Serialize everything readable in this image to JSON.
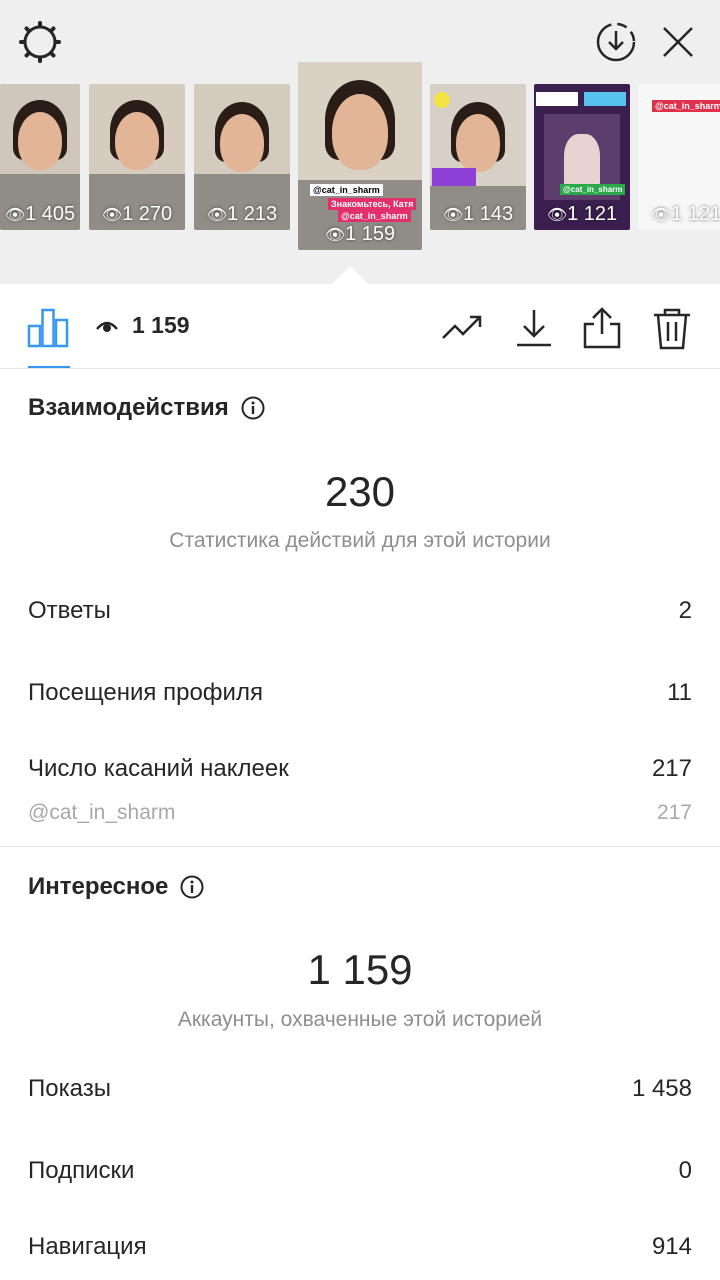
{
  "header": {
    "settings_icon": "gear-icon",
    "download_icon": "download-circle-icon",
    "close_icon": "close-icon"
  },
  "stories": [
    {
      "views": "1 405"
    },
    {
      "views": "1 270"
    },
    {
      "views": "1 213"
    },
    {
      "views": "1 159",
      "mention": "@cat_in_sharm",
      "caption": "Знакомьтесь, Катя",
      "mention2": "@cat_in_sharm"
    },
    {
      "views": "1 143"
    },
    {
      "views": "1 121",
      "mention": "@cat_in_sharm"
    },
    {
      "views": "1 121",
      "mention": "@cat_in_sharm"
    }
  ],
  "toolbar": {
    "views": "1 159",
    "icons": [
      "bar-chart-icon",
      "eye-icon",
      "trending-icon",
      "download-icon",
      "share-icon",
      "trash-icon"
    ]
  },
  "interactions": {
    "title": "Взаимодействия",
    "total": "230",
    "subtitle": "Статистика действий для этой истории",
    "rows": [
      {
        "label": "Ответы",
        "value": "2"
      },
      {
        "label": "Посещения профиля",
        "value": "11"
      },
      {
        "label": "Число касаний наклеек",
        "value": "217"
      }
    ],
    "sub_row": {
      "label": "@cat_in_sharm",
      "value": "217"
    }
  },
  "discovery": {
    "title": "Интересное",
    "total": "1 159",
    "subtitle": "Аккаунты, охваченные этой историей",
    "rows": [
      {
        "label": "Показы",
        "value": "1 458"
      },
      {
        "label": "Подписки",
        "value": "0"
      },
      {
        "label": "Навигация",
        "value": "914"
      }
    ]
  },
  "colors": {
    "accent": "#3897f0",
    "text": "#262626",
    "muted": "#8e8e8e",
    "top_bg": "#efefef"
  }
}
